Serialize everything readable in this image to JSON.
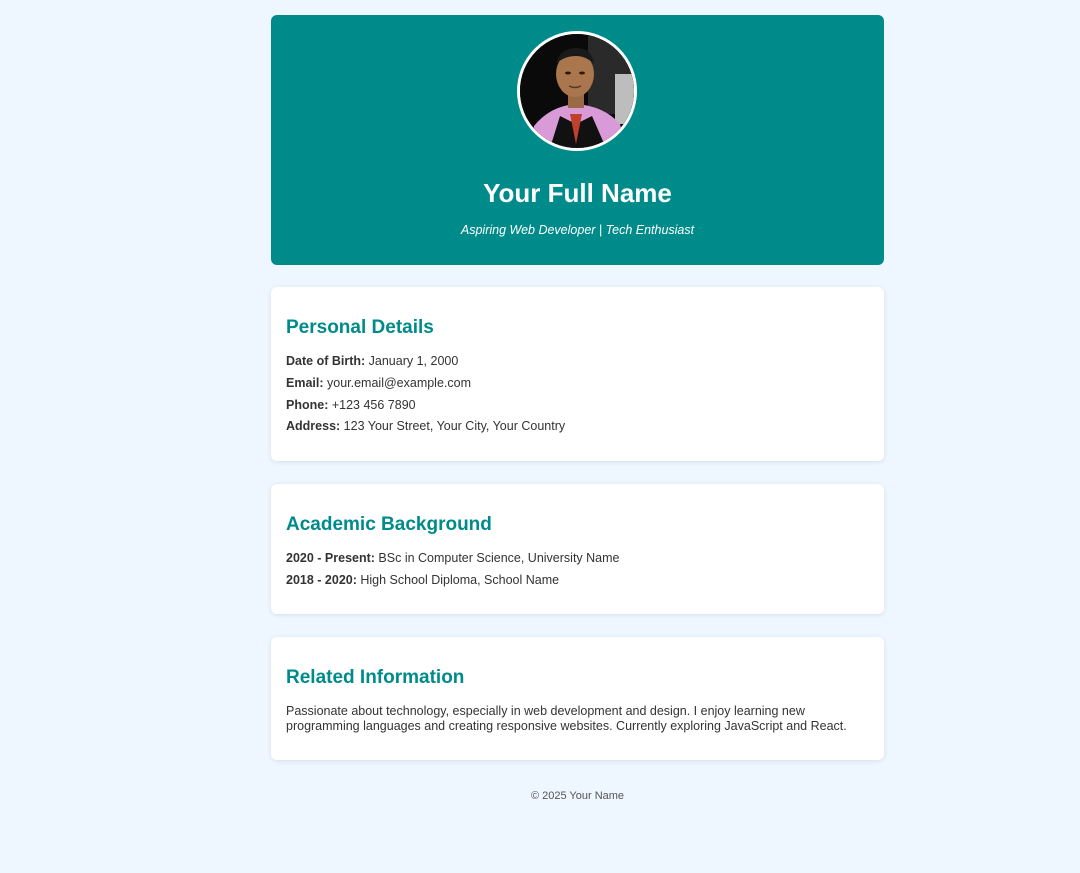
{
  "header": {
    "name": "Your Full Name",
    "tagline": "Aspiring Web Developer | Tech Enthusiast",
    "background_color": "#008b8b"
  },
  "personal": {
    "title": "Personal Details",
    "items": [
      {
        "label": "Date of Birth:",
        "value": "January 1, 2000"
      },
      {
        "label": "Email:",
        "value": "your.email@example.com"
      },
      {
        "label": "Phone:",
        "value": "+123 456 7890"
      },
      {
        "label": "Address:",
        "value": "123 Your Street, Your City, Your Country"
      }
    ]
  },
  "academic": {
    "title": "Academic Background",
    "items": [
      {
        "label": "2020 - Present:",
        "value": "BSc in Computer Science, University Name"
      },
      {
        "label": "2018 - 2020:",
        "value": "High School Diploma, School Name"
      }
    ]
  },
  "related": {
    "title": "Related Information",
    "text": "Passionate about technology, especially in web development and design. I enjoy learning new programming languages and creating responsive websites. Currently exploring JavaScript and React."
  },
  "footer": {
    "text": "© 2025 Your Name"
  },
  "colors": {
    "accent": "#008b8b",
    "page_background": "#eef6ff",
    "card_background": "#ffffff"
  }
}
